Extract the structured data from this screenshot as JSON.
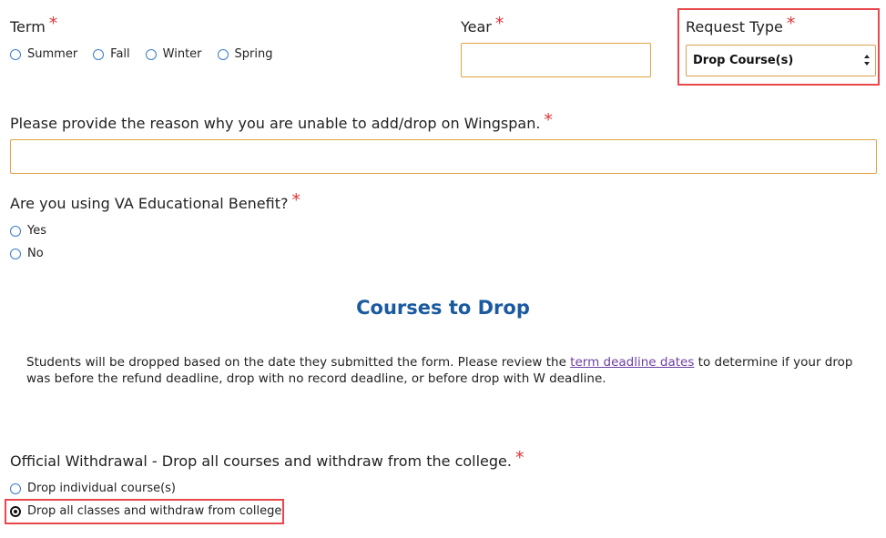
{
  "term": {
    "label": "Term",
    "required_mark": "*",
    "options": [
      "Summer",
      "Fall",
      "Winter",
      "Spring"
    ]
  },
  "year": {
    "label": "Year",
    "required_mark": "*",
    "value": ""
  },
  "request_type": {
    "label": "Request Type",
    "required_mark": "*",
    "selected": "Drop Course(s)"
  },
  "reason": {
    "label": "Please provide the reason why you are unable to add/drop on Wingspan.",
    "required_mark": "*",
    "value": ""
  },
  "va_benefit": {
    "label": "Are you using VA Educational Benefit?",
    "required_mark": "*",
    "options": [
      "Yes",
      "No"
    ]
  },
  "courses_section": {
    "heading": "Courses to Drop",
    "para_before": "Students will be dropped based on the date they submitted the form. Please review the ",
    "link_text": "term deadline dates",
    "para_after": " to determine if your drop was before the refund deadline, drop with no record deadline, or before drop with W deadline."
  },
  "withdrawal": {
    "label": "Official Withdrawal - Drop all courses and withdraw from the college.",
    "required_mark": "*",
    "options": [
      "Drop individual course(s)",
      "Drop all classes and withdraw from college"
    ],
    "selected_index": 1
  },
  "colors": {
    "required": "#e0353b",
    "heading": "#1a5aa0",
    "input_border": "#e0a441",
    "highlight": "#e8474b",
    "link": "#6b3fa0",
    "radio": "#3b7bc8"
  }
}
